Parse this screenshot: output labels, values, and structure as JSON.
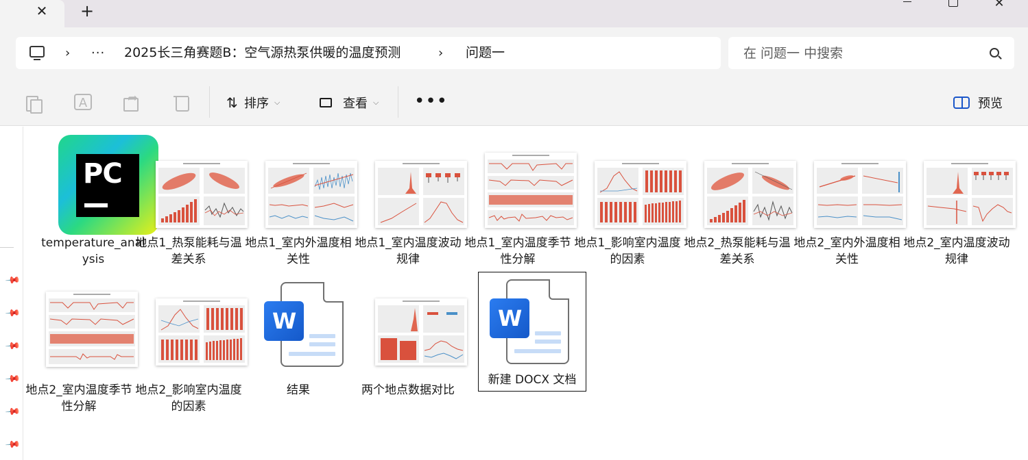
{
  "tab": {
    "close_icon": "✕",
    "new_tab_icon": "+"
  },
  "window": {
    "close_icon": "✕"
  },
  "address": {
    "chevron": "›",
    "more": "···",
    "crumbs": [
      "2025长三角赛题B：空气源热泵供暖的温度预测",
      "问题一"
    ]
  },
  "search": {
    "placeholder": "在 问题一 中搜索"
  },
  "toolbar": {
    "rename_glyph": "A",
    "sort_icon": "⇅",
    "sort_label": "排序",
    "view_label": "查看",
    "dropdown": "⌵",
    "more": "•••",
    "preview_label": "预览"
  },
  "nav": {
    "pin_glyph": "📌"
  },
  "files": [
    {
      "name": "temperature_analysis",
      "type": "pycharm-project"
    },
    {
      "name": "地点1_热泵能耗与温差关系",
      "type": "image"
    },
    {
      "name": "地点1_室内外温度相关性",
      "type": "image"
    },
    {
      "name": "地点1_室内温度波动规律",
      "type": "image"
    },
    {
      "name": "地点1_室内温度季节性分解",
      "type": "image"
    },
    {
      "name": "地点1_影响室内温度的因素",
      "type": "image"
    },
    {
      "name": "地点2_热泵能耗与温差关系",
      "type": "image"
    },
    {
      "name": "地点2_室内外温度相关性",
      "type": "image"
    },
    {
      "name": "地点2_室内温度波动规律",
      "type": "image"
    },
    {
      "name": "地点2_室内温度季节性分解",
      "type": "image"
    },
    {
      "name": "地点2_影响室内温度的因素",
      "type": "image"
    },
    {
      "name": "结果",
      "type": "docx"
    },
    {
      "name": "两个地点数据对比",
      "type": "image"
    },
    {
      "name": "新建 DOCX 文档",
      "type": "docx",
      "selected": true
    }
  ],
  "pycharm_icon_text": "PC",
  "word_icon_text": "W",
  "colors": {
    "accent": "#1a56c9",
    "chart_red": "#d9513d",
    "chart_blue": "#4a90c8"
  }
}
